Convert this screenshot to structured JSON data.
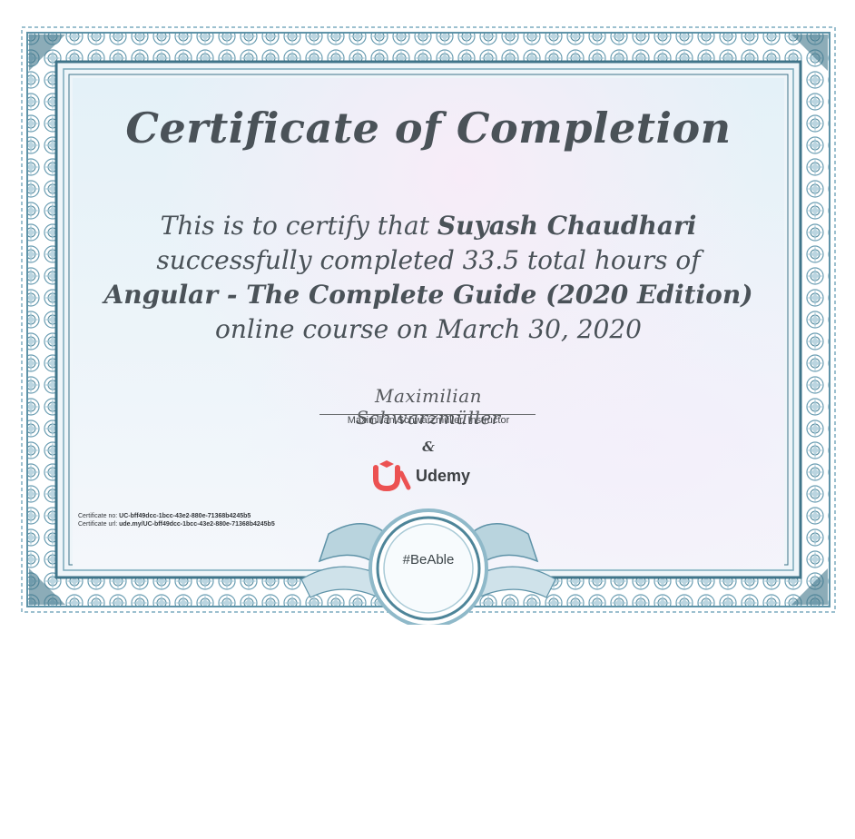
{
  "certificate": {
    "title": "Certificate of Completion",
    "line1_prefix": "This is to certify that ",
    "recipient": "Suyash Chaudhari",
    "line2": "successfully completed 33.5 total hours of",
    "course": "Angular - The Complete Guide (2020 Edition)",
    "line4": "online course on March 30, 2020",
    "signature": "Maximilian Schwarzmüller",
    "signature_caption": "Maximilian Schwarzmüller, Instructor",
    "ampersand": "&",
    "brand": "Udemy",
    "seal_text": "#BeAble",
    "cert_no_label": "Certificate no: ",
    "cert_no": "UC-bff49dcc-1bcc-43e2-880e-71368b4245b5",
    "cert_url_label": "Certificate url: ",
    "cert_url": "ude.my/UC-bff49dcc-1bcc-43e2-880e-71368b4245b5"
  },
  "colors": {
    "text": "#4a5258",
    "border": "#5f93a8",
    "border_dark": "#3f7489",
    "udemy_red": "#ec5252"
  }
}
